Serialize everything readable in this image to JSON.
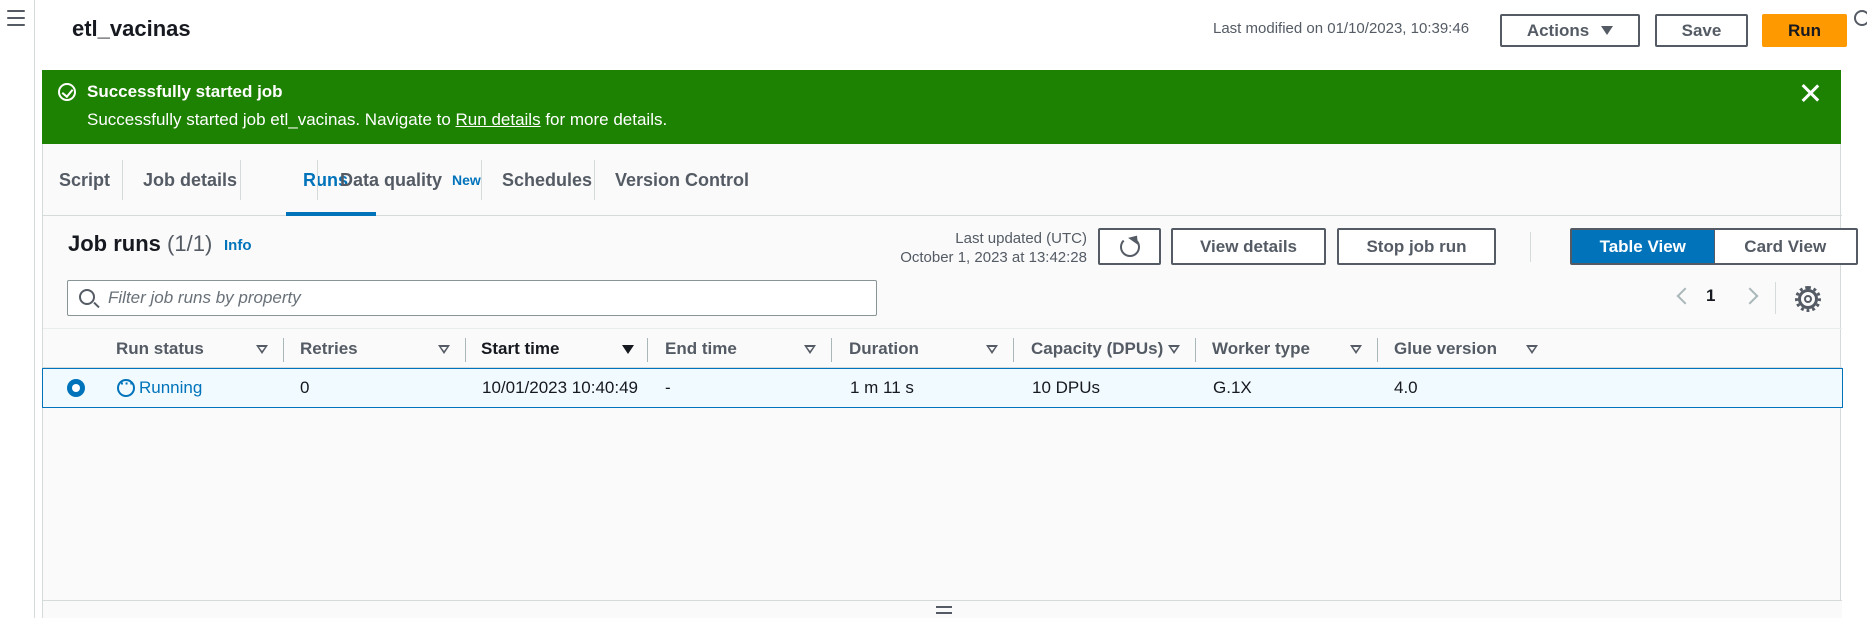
{
  "header": {
    "job_name": "etl_vacinas",
    "last_modified": "Last modified on 01/10/2023, 10:39:46",
    "actions_label": "Actions",
    "save_label": "Save",
    "run_label": "Run"
  },
  "flash": {
    "title": "Successfully started job",
    "message_prefix": "Successfully started job etl_vacinas. Navigate to ",
    "link_text": "Run details",
    "message_suffix": " for more details."
  },
  "tabs": {
    "script": "Script",
    "job_details": "Job details",
    "runs": "Runs",
    "data_quality": "Data quality",
    "new_badge": "New",
    "schedules": "Schedules",
    "version_control": "Version Control"
  },
  "runs": {
    "title": "Job runs",
    "count": "(1/1)",
    "info": "Info",
    "last_updated_label": "Last updated (UTC)",
    "last_updated_value": "October 1, 2023 at 13:42:28",
    "view_details_label": "View details",
    "stop_label": "Stop job run",
    "table_view_label": "Table View",
    "card_view_label": "Card View",
    "filter_placeholder": "Filter job runs by property",
    "page": "1"
  },
  "table": {
    "columns": [
      "Run status",
      "Retries",
      "Start time",
      "End time",
      "Duration",
      "Capacity (DPUs)",
      "Worker type",
      "Glue version"
    ],
    "rows": [
      {
        "run_status": "Running",
        "retries": "0",
        "start_time": "10/01/2023 10:40:49",
        "end_time": "-",
        "duration": "1 m 11 s",
        "capacity": "10 DPUs",
        "worker_type": "G.1X",
        "glue_version": "4.0"
      }
    ]
  },
  "colors": {
    "success_green": "#1d8102",
    "primary_orange": "#ff9900",
    "link_blue": "#0073bb"
  },
  "icons": {
    "menu": "hamburger-icon",
    "flash": "check-circle-icon",
    "close": "close-icon",
    "refresh": "refresh-icon",
    "search": "search-icon",
    "settings": "gear-icon",
    "status": "ellipsis-circle-icon"
  }
}
